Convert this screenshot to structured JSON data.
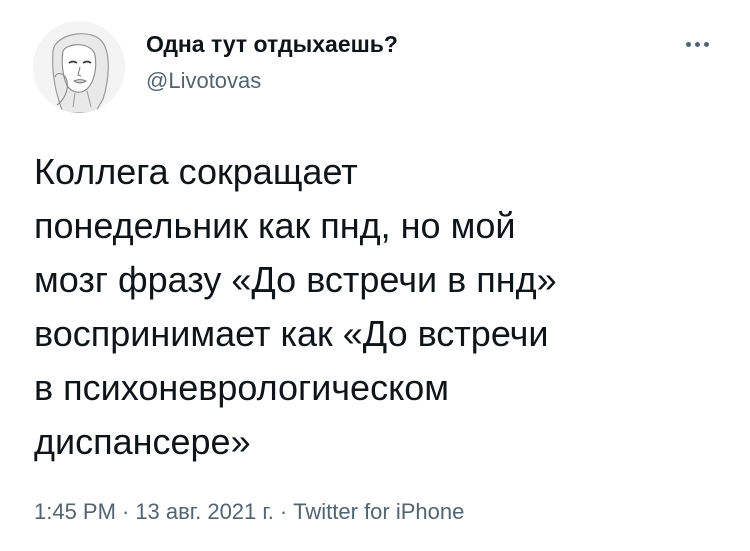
{
  "author": {
    "display_name": "Одна тут отдыхаешь?",
    "handle": "@Livotovas"
  },
  "tweet": {
    "text": "Коллега сокращает\nпонедельник как пнд, но мой\nмозг фразу «До встречи в пнд»\nвоспринимает как «До встречи\nв психоневрологическом\nдиспансере»"
  },
  "meta": {
    "time": "1:45 PM",
    "separator": "·",
    "date": "13 авг. 2021 г.",
    "source": "Twitter for iPhone"
  },
  "icons": {
    "menu": "more-options-icon",
    "avatar": "profile-avatar"
  },
  "colors": {
    "text_primary": "#0f1419",
    "text_secondary": "#536471",
    "background": "#ffffff"
  }
}
